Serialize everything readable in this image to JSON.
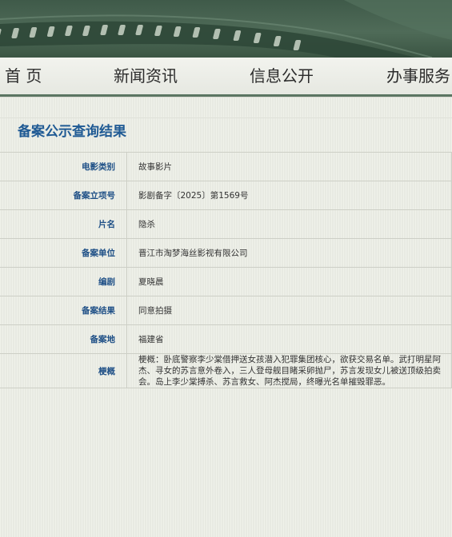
{
  "nav": {
    "items": [
      "首 页",
      "新闻资讯",
      "信息公开",
      "办事服务"
    ]
  },
  "result": {
    "title": "备案公示查询结果",
    "rows": [
      {
        "label": "电影类别",
        "value": "故事影片"
      },
      {
        "label": "备案立项号",
        "value": "影剧备字〔2025〕第1569号"
      },
      {
        "label": "片名",
        "value": "隐杀"
      },
      {
        "label": "备案单位",
        "value": "晋江市淘梦海丝影视有限公司"
      },
      {
        "label": "编剧",
        "value": "夏晓晨"
      },
      {
        "label": "备案结果",
        "value": "同意拍摄"
      },
      {
        "label": "备案地",
        "value": "福建省"
      },
      {
        "label": "梗概",
        "value": "梗概：卧底警察李少棠借押送女孩潜入犯罪集团核心，欲获交易名单。武打明星阿杰、寻女的苏言意外卷入，三人登母舰目睹采卵抛尸，苏言发现女儿被送顶级拍卖会。岛上李少棠搏杀、苏言救女、阿杰搅局，终曝光名单摧毁罪恶。"
      }
    ]
  },
  "colors": {
    "banner": "#46624f",
    "nav_border": "#5b7562",
    "title": "#1f5a94",
    "label": "#1e4f86"
  }
}
